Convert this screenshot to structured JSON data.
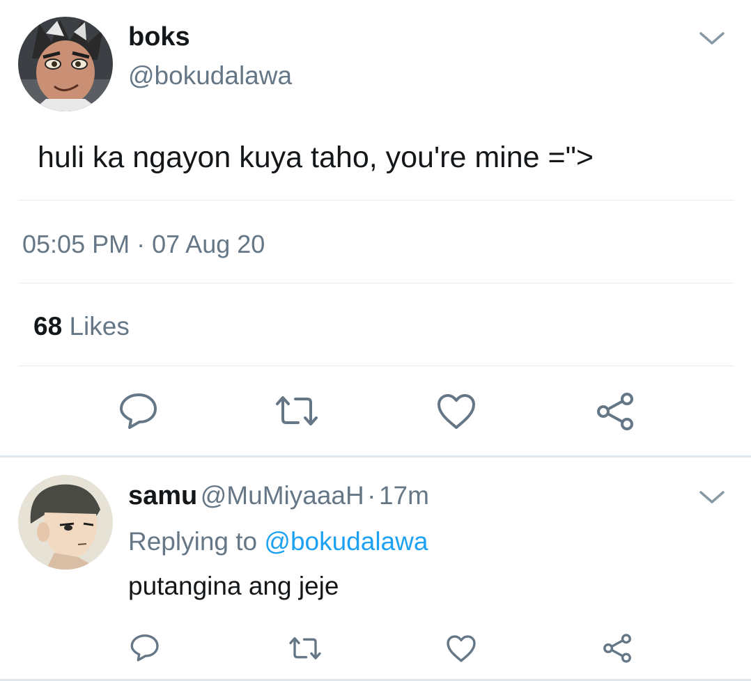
{
  "tweet": {
    "author_name": "boks",
    "author_handle": "@bokudalawa",
    "text": "huli ka ngayon kuya taho, you're mine =\">",
    "time": "05:05 PM",
    "separator": "·",
    "date": "07 Aug 20",
    "likes_count": "68",
    "likes_label": "Likes"
  },
  "reply": {
    "author_name": "samu",
    "author_handle": "@MuMiyaaaH",
    "separator": "·",
    "age": "17m",
    "replying_prefix": "Replying to",
    "replying_to": "@bokudalawa",
    "text": "putangina ang jeje"
  },
  "icons": {
    "reply": "reply-icon",
    "retweet": "retweet-icon",
    "like": "heart-icon",
    "share": "share-icon",
    "caret": "chevron-down-icon"
  },
  "colors": {
    "text": "#14171a",
    "secondary": "#657786",
    "link": "#1da1f2",
    "divider": "#e6ecf0"
  }
}
